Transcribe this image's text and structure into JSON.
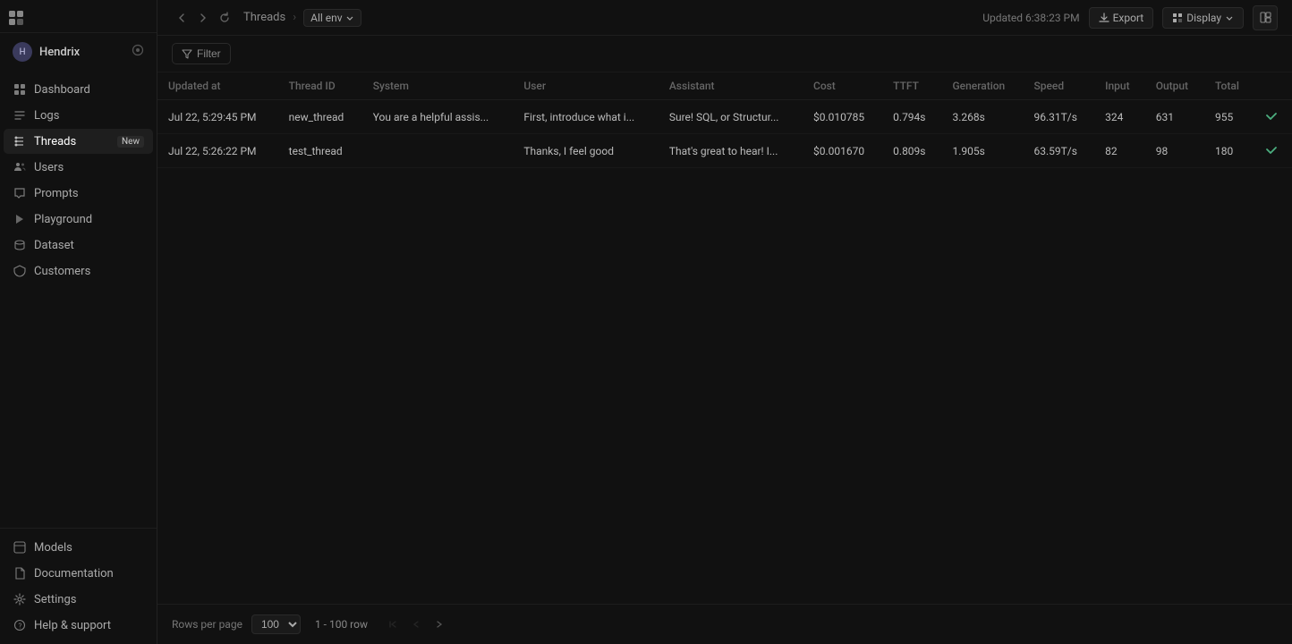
{
  "sidebar": {
    "logo_label": "App Logo",
    "user": {
      "name": "Hendrix",
      "avatar_initials": "H"
    },
    "nav_items": [
      {
        "id": "dashboard",
        "label": "Dashboard",
        "icon": "grid-icon",
        "active": false
      },
      {
        "id": "logs",
        "label": "Logs",
        "icon": "log-icon",
        "active": false
      },
      {
        "id": "threads",
        "label": "Threads",
        "icon": "threads-icon",
        "active": true,
        "badge": "New"
      },
      {
        "id": "users",
        "label": "Users",
        "icon": "users-icon",
        "active": false
      },
      {
        "id": "prompts",
        "label": "Prompts",
        "icon": "prompts-icon",
        "active": false
      },
      {
        "id": "playground",
        "label": "Playground",
        "icon": "playground-icon",
        "active": false
      },
      {
        "id": "dataset",
        "label": "Dataset",
        "icon": "dataset-icon",
        "active": false
      },
      {
        "id": "customers",
        "label": "Customers",
        "icon": "customers-icon",
        "active": false
      }
    ],
    "bottom_items": [
      {
        "id": "models",
        "label": "Models",
        "icon": "models-icon"
      },
      {
        "id": "documentation",
        "label": "Documentation",
        "icon": "docs-icon"
      },
      {
        "id": "settings",
        "label": "Settings",
        "icon": "settings-icon"
      },
      {
        "id": "help",
        "label": "Help & support",
        "icon": "help-icon"
      }
    ]
  },
  "topbar": {
    "breadcrumb_root": "Threads",
    "breadcrumb_sep": "›",
    "breadcrumb_env": "All env",
    "updated_label": "Updated 6:38:23 PM",
    "export_label": "Export",
    "display_label": "Display"
  },
  "toolbar": {
    "filter_label": "Filter"
  },
  "table": {
    "columns": [
      {
        "id": "updated_at",
        "label": "Updated at"
      },
      {
        "id": "thread_id",
        "label": "Thread ID"
      },
      {
        "id": "system",
        "label": "System"
      },
      {
        "id": "user",
        "label": "User"
      },
      {
        "id": "assistant",
        "label": "Assistant"
      },
      {
        "id": "cost",
        "label": "Cost"
      },
      {
        "id": "ttft",
        "label": "TTFT"
      },
      {
        "id": "generation",
        "label": "Generation"
      },
      {
        "id": "speed",
        "label": "Speed"
      },
      {
        "id": "input",
        "label": "Input"
      },
      {
        "id": "output",
        "label": "Output"
      },
      {
        "id": "total",
        "label": "Total"
      }
    ],
    "rows": [
      {
        "updated_at": "Jul 22, 5:29:45 PM",
        "thread_id": "new_thread",
        "system": "You are a helpful assis...",
        "user": "First, introduce what i...",
        "assistant": "Sure! SQL, or Structur...",
        "cost": "$0.010785",
        "ttft": "0.794s",
        "generation": "3.268s",
        "speed": "96.31T/s",
        "input": "324",
        "output": "631",
        "total": "955"
      },
      {
        "updated_at": "Jul 22, 5:26:22 PM",
        "thread_id": "test_thread",
        "system": "",
        "user": "Thanks, I feel good",
        "assistant": "That's great to hear! I...",
        "cost": "$0.001670",
        "ttft": "0.809s",
        "generation": "1.905s",
        "speed": "63.59T/s",
        "input": "82",
        "output": "98",
        "total": "180"
      }
    ]
  },
  "footer": {
    "rows_per_page_label": "Rows per page",
    "rows_per_page_value": "100",
    "rows_range": "1 - 100 row"
  }
}
